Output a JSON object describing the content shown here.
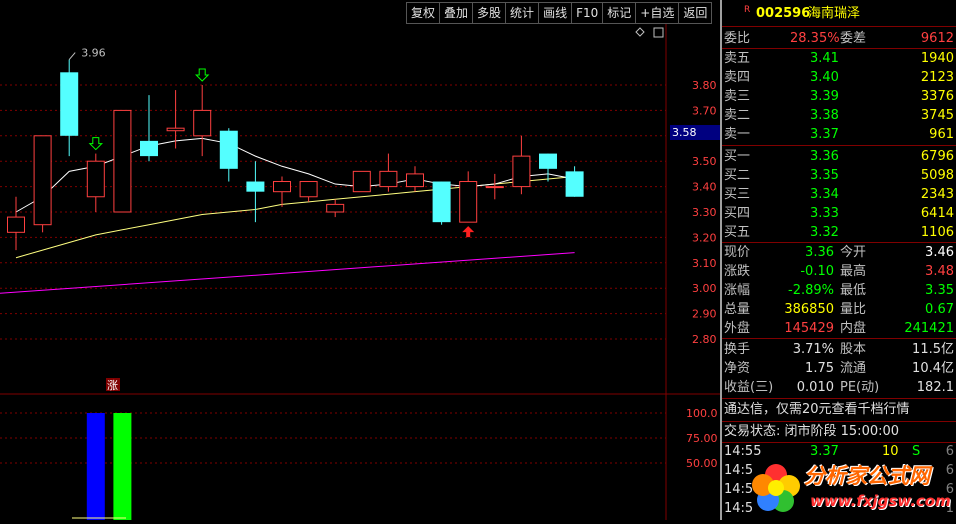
{
  "toolbar": {
    "items": [
      "复权",
      "叠加",
      "多股",
      "统计",
      "画线",
      "F10",
      "标记",
      "+自选",
      "返回"
    ]
  },
  "stock": {
    "r_badge": "R",
    "code": "002596",
    "name": "海南瑞泽"
  },
  "chart_data": {
    "type": "candlestick",
    "annotations": {
      "high_label": "3.96",
      "zhang_marker": "涨"
    },
    "price_axis_ticks": [
      "3.80",
      "3.70",
      "3.60",
      "3.50",
      "3.40",
      "3.30",
      "3.20",
      "3.10",
      "3.00",
      "2.90",
      "2.80"
    ],
    "current_price_tag": "3.58",
    "candles": [
      {
        "o": 3.22,
        "c": 3.28,
        "h": 3.36,
        "l": 3.15
      },
      {
        "o": 3.25,
        "c": 3.6,
        "h": 3.6,
        "l": 3.22
      },
      {
        "o": 3.85,
        "c": 3.6,
        "h": 3.9,
        "l": 3.52
      },
      {
        "o": 3.36,
        "c": 3.5,
        "h": 3.53,
        "l": 3.3
      },
      {
        "o": 3.3,
        "c": 3.7,
        "h": 3.7,
        "l": 3.3
      },
      {
        "o": 3.58,
        "c": 3.52,
        "h": 3.76,
        "l": 3.5
      },
      {
        "o": 3.62,
        "c": 3.63,
        "h": 3.78,
        "l": 3.55
      },
      {
        "o": 3.6,
        "c": 3.7,
        "h": 3.8,
        "l": 3.52
      },
      {
        "o": 3.62,
        "c": 3.47,
        "h": 3.63,
        "l": 3.42
      },
      {
        "o": 3.42,
        "c": 3.38,
        "h": 3.5,
        "l": 3.26
      },
      {
        "o": 3.38,
        "c": 3.42,
        "h": 3.44,
        "l": 3.32
      },
      {
        "o": 3.36,
        "c": 3.42,
        "h": 3.42,
        "l": 3.34
      },
      {
        "o": 3.3,
        "c": 3.33,
        "h": 3.35,
        "l": 3.28
      },
      {
        "o": 3.38,
        "c": 3.46,
        "h": 3.46,
        "l": 3.38
      },
      {
        "o": 3.4,
        "c": 3.46,
        "h": 3.53,
        "l": 3.38
      },
      {
        "o": 3.4,
        "c": 3.45,
        "h": 3.48,
        "l": 3.38
      },
      {
        "o": 3.42,
        "c": 3.26,
        "h": 3.42,
        "l": 3.25
      },
      {
        "o": 3.26,
        "c": 3.42,
        "h": 3.46,
        "l": 3.26
      },
      {
        "o": 3.4,
        "c": 3.4,
        "h": 3.45,
        "l": 3.35
      },
      {
        "o": 3.4,
        "c": 3.52,
        "h": 3.6,
        "l": 3.37
      },
      {
        "o": 3.53,
        "c": 3.47,
        "h": 3.53,
        "l": 3.42
      },
      {
        "o": 3.46,
        "c": 3.36,
        "h": 3.48,
        "l": 3.36
      }
    ],
    "ma_white": [
      3.3,
      3.36,
      3.46,
      3.48,
      3.52,
      3.56,
      3.58,
      3.59,
      3.57,
      3.52,
      3.48,
      3.45,
      3.41,
      3.4,
      3.41,
      3.43,
      3.41,
      3.4,
      3.41,
      3.44,
      3.45,
      3.43
    ],
    "ma_yellow": [
      3.12,
      3.15,
      3.18,
      3.21,
      3.23,
      3.25,
      3.27,
      3.29,
      3.3,
      3.31,
      3.33,
      3.34,
      3.35,
      3.36,
      3.37,
      3.38,
      3.39,
      3.4,
      3.41,
      3.42,
      3.43,
      3.44
    ],
    "ma_magenta_start": 2.98,
    "ma_magenta_end": 3.14,
    "signals": {
      "down_arrow_candles": [
        3,
        7
      ],
      "up_arrow_candle": 17
    },
    "volume_axis_ticks": [
      "100.0",
      "75.00",
      "50.00"
    ],
    "volume_bars": [
      {
        "candle": 3,
        "value": 100,
        "color": "#0000ff"
      },
      {
        "candle": 4,
        "value": 100,
        "color": "#00ff00"
      }
    ]
  },
  "quote": {
    "weibi": {
      "label": "委比",
      "value": "28.35%",
      "label2": "委差",
      "value2": "9612"
    },
    "sells": [
      {
        "label": "卖五",
        "price": "3.41",
        "vol": "1940"
      },
      {
        "label": "卖四",
        "price": "3.40",
        "vol": "2123"
      },
      {
        "label": "卖三",
        "price": "3.39",
        "vol": "3376"
      },
      {
        "label": "卖二",
        "price": "3.38",
        "vol": "3745"
      },
      {
        "label": "卖一",
        "price": "3.37",
        "vol": "961"
      }
    ],
    "buys": [
      {
        "label": "买一",
        "price": "3.36",
        "vol": "6796"
      },
      {
        "label": "买二",
        "price": "3.35",
        "vol": "5098"
      },
      {
        "label": "买三",
        "price": "3.34",
        "vol": "2343"
      },
      {
        "label": "买四",
        "price": "3.33",
        "vol": "6414"
      },
      {
        "label": "买五",
        "price": "3.32",
        "vol": "1106"
      }
    ],
    "stats": [
      {
        "l1": "现价",
        "v1": "3.36",
        "c1": "#00ff00",
        "l2": "今开",
        "v2": "3.46",
        "c2": "#ffffff"
      },
      {
        "l1": "涨跌",
        "v1": "-0.10",
        "c1": "#00ff00",
        "l2": "最高",
        "v2": "3.48",
        "c2": "#ff4040"
      },
      {
        "l1": "涨幅",
        "v1": "-2.89%",
        "c1": "#00ff00",
        "l2": "最低",
        "v2": "3.35",
        "c2": "#00ff00"
      },
      {
        "l1": "总量",
        "v1": "386850",
        "c1": "#ffff00",
        "l2": "量比",
        "v2": "0.67",
        "c2": "#00ff00"
      },
      {
        "l1": "外盘",
        "v1": "145429",
        "c1": "#ff4040",
        "l2": "内盘",
        "v2": "241421",
        "c2": "#00ff00"
      }
    ],
    "info": [
      {
        "l1": "换手",
        "v1": "3.71%",
        "l2": "股本",
        "v2": "11.5亿"
      },
      {
        "l1": "净资",
        "v1": "1.75",
        "l2": "流通",
        "v2": "10.4亿"
      },
      {
        "l1": "收益(三)",
        "v1": "0.010",
        "l2": "PE(动)",
        "v2": "182.1"
      }
    ],
    "promo": "通达信，仅需20元查看千档行情",
    "trade_status": "交易状态: 闭市阶段 15:00:00",
    "ticks": [
      {
        "time": "14:55",
        "price": "3.37",
        "vol": "10",
        "side": "S",
        "num": "6"
      },
      {
        "time": "14:5",
        "price": "",
        "vol": "",
        "side": "",
        "num": "6"
      },
      {
        "time": "14:5",
        "price": "",
        "vol": "",
        "side": "",
        "num": "6"
      },
      {
        "time": "14:5",
        "price": "",
        "vol": "",
        "side": "",
        "num": "1"
      }
    ]
  },
  "watermark": {
    "title": "分析家公式网",
    "url": "www.fxjgsw.com"
  },
  "colors": {
    "up": "#ff4040",
    "down": "#54ffff",
    "grid": "#800000",
    "accent_red": "#ff4040",
    "accent_green": "#00ff00",
    "axis_text": "#ff4040",
    "ma_white": "#ffffff",
    "ma_yellow": "#ffff80",
    "ma_magenta": "#ff00ff"
  }
}
